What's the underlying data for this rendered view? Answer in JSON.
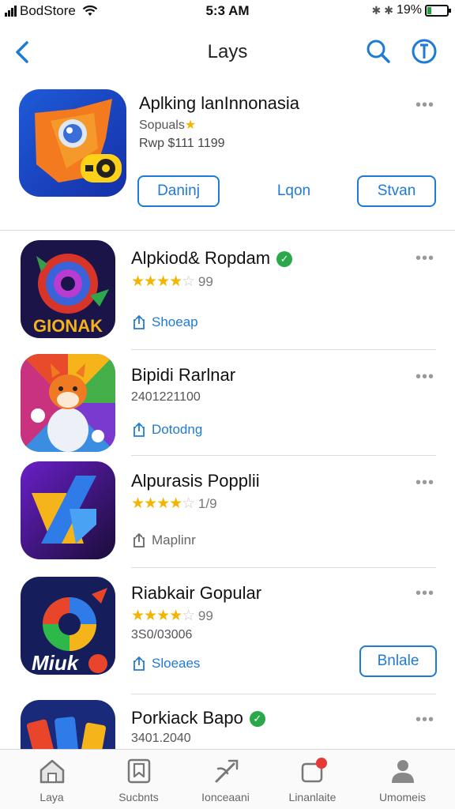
{
  "status_bar": {
    "carrier": "BodStore",
    "time": "5:3 AM",
    "battery_text": "19%",
    "battery_level": 0.19
  },
  "nav": {
    "title": "Lays"
  },
  "featured": {
    "name": "Aplking lanInnonasia",
    "subtitle": "Sopuals",
    "price": "Rwp $111 1199",
    "buttons": {
      "primary": "Daninj",
      "middle": "Lqon",
      "secondary": "Stvan"
    }
  },
  "apps": [
    {
      "name": "Alpkiod& Ropdam",
      "verified": true,
      "stars": 4,
      "rating": "99",
      "line": "",
      "action": "Shoeap",
      "action_style": "blue",
      "button": ""
    },
    {
      "name": "Bipidi Rarlnar",
      "verified": false,
      "stars": 0,
      "rating": "",
      "line": "2401221100",
      "action": "Dotodng",
      "action_style": "blue",
      "button": ""
    },
    {
      "name": "Alpurasis Popplii",
      "verified": false,
      "stars": 4,
      "rating": "1/9",
      "line": "",
      "action": "Maplinr",
      "action_style": "gray",
      "button": ""
    },
    {
      "name": "Riabkair Gopular",
      "verified": false,
      "stars": 4,
      "rating": "99",
      "line": "3S0/03006",
      "action": "Sloeaes",
      "action_style": "blue",
      "button": "Bnlale"
    },
    {
      "name": "Porkiack Bapo",
      "verified": true,
      "stars": 0,
      "rating": "",
      "line": "3401.2040",
      "action": "",
      "action_style": "blue",
      "button": ""
    }
  ],
  "tabs": [
    {
      "label": "Laya",
      "icon": "home-icon"
    },
    {
      "label": "Sucbnts",
      "icon": "bookmark-icon"
    },
    {
      "label": "Ionceaani",
      "icon": "tools-icon"
    },
    {
      "label": "Linanlaite",
      "icon": "notifications-icon"
    },
    {
      "label": "Umomeis",
      "icon": "person-icon"
    }
  ],
  "colors": {
    "accent": "#1e7ad6",
    "star": "#f5b400",
    "verified": "#2aa84a",
    "battery": "#1aa33a",
    "badge": "#e53935"
  }
}
